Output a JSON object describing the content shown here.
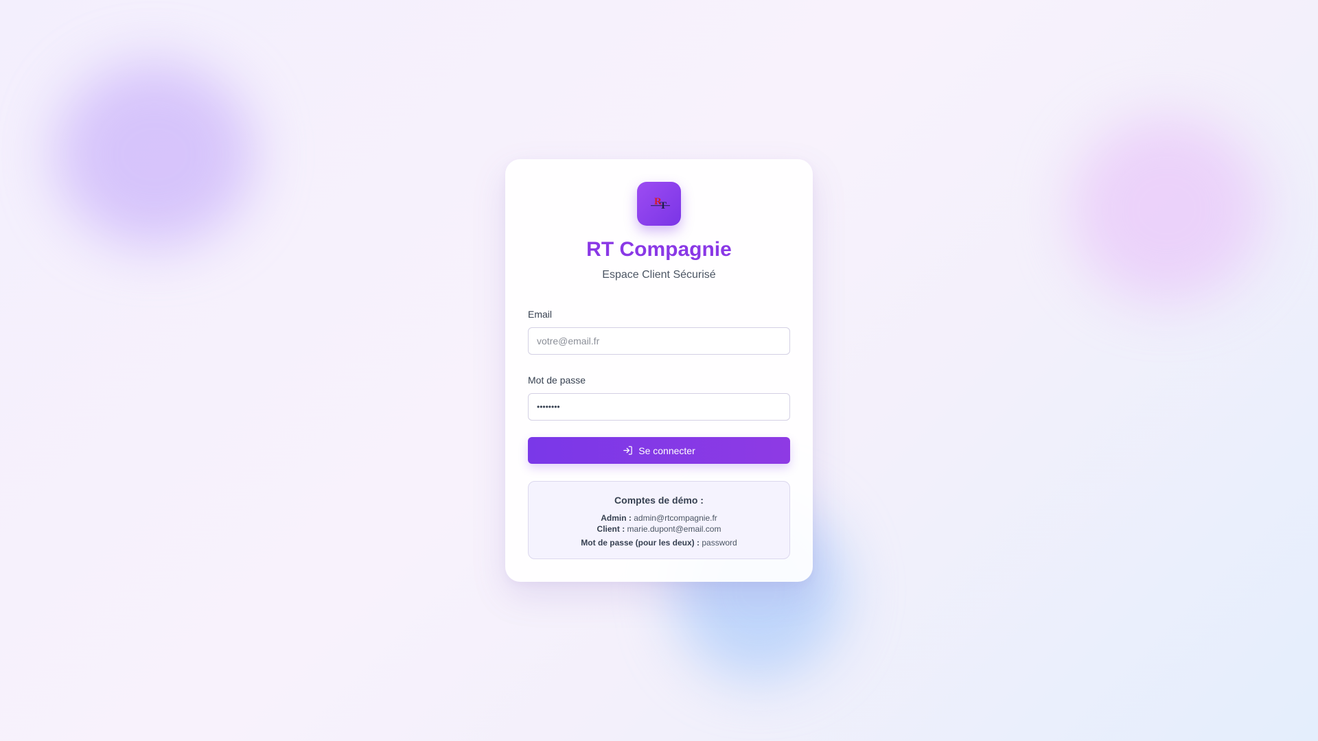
{
  "brand": {
    "title": "RT Compagnie",
    "subtitle": "Espace Client Sécurisé",
    "logo_letters": "RT"
  },
  "form": {
    "email_label": "Email",
    "email_placeholder": "votre@email.fr",
    "password_label": "Mot de passe",
    "password_value": "••••••••",
    "submit_label": "Se connecter",
    "submit_icon": "login-icon"
  },
  "demo": {
    "title": "Comptes de démo :",
    "admin_label": "Admin :",
    "admin_email": "admin@rtcompagnie.fr",
    "client_label": "Client :",
    "client_email": "marie.dupont@email.com",
    "password_label": "Mot de passe (pour les deux) :",
    "password_value": "password"
  },
  "colors": {
    "accent": "#8a38e6",
    "button": "#7a38e8",
    "demo_background": "#f5f3fe"
  }
}
